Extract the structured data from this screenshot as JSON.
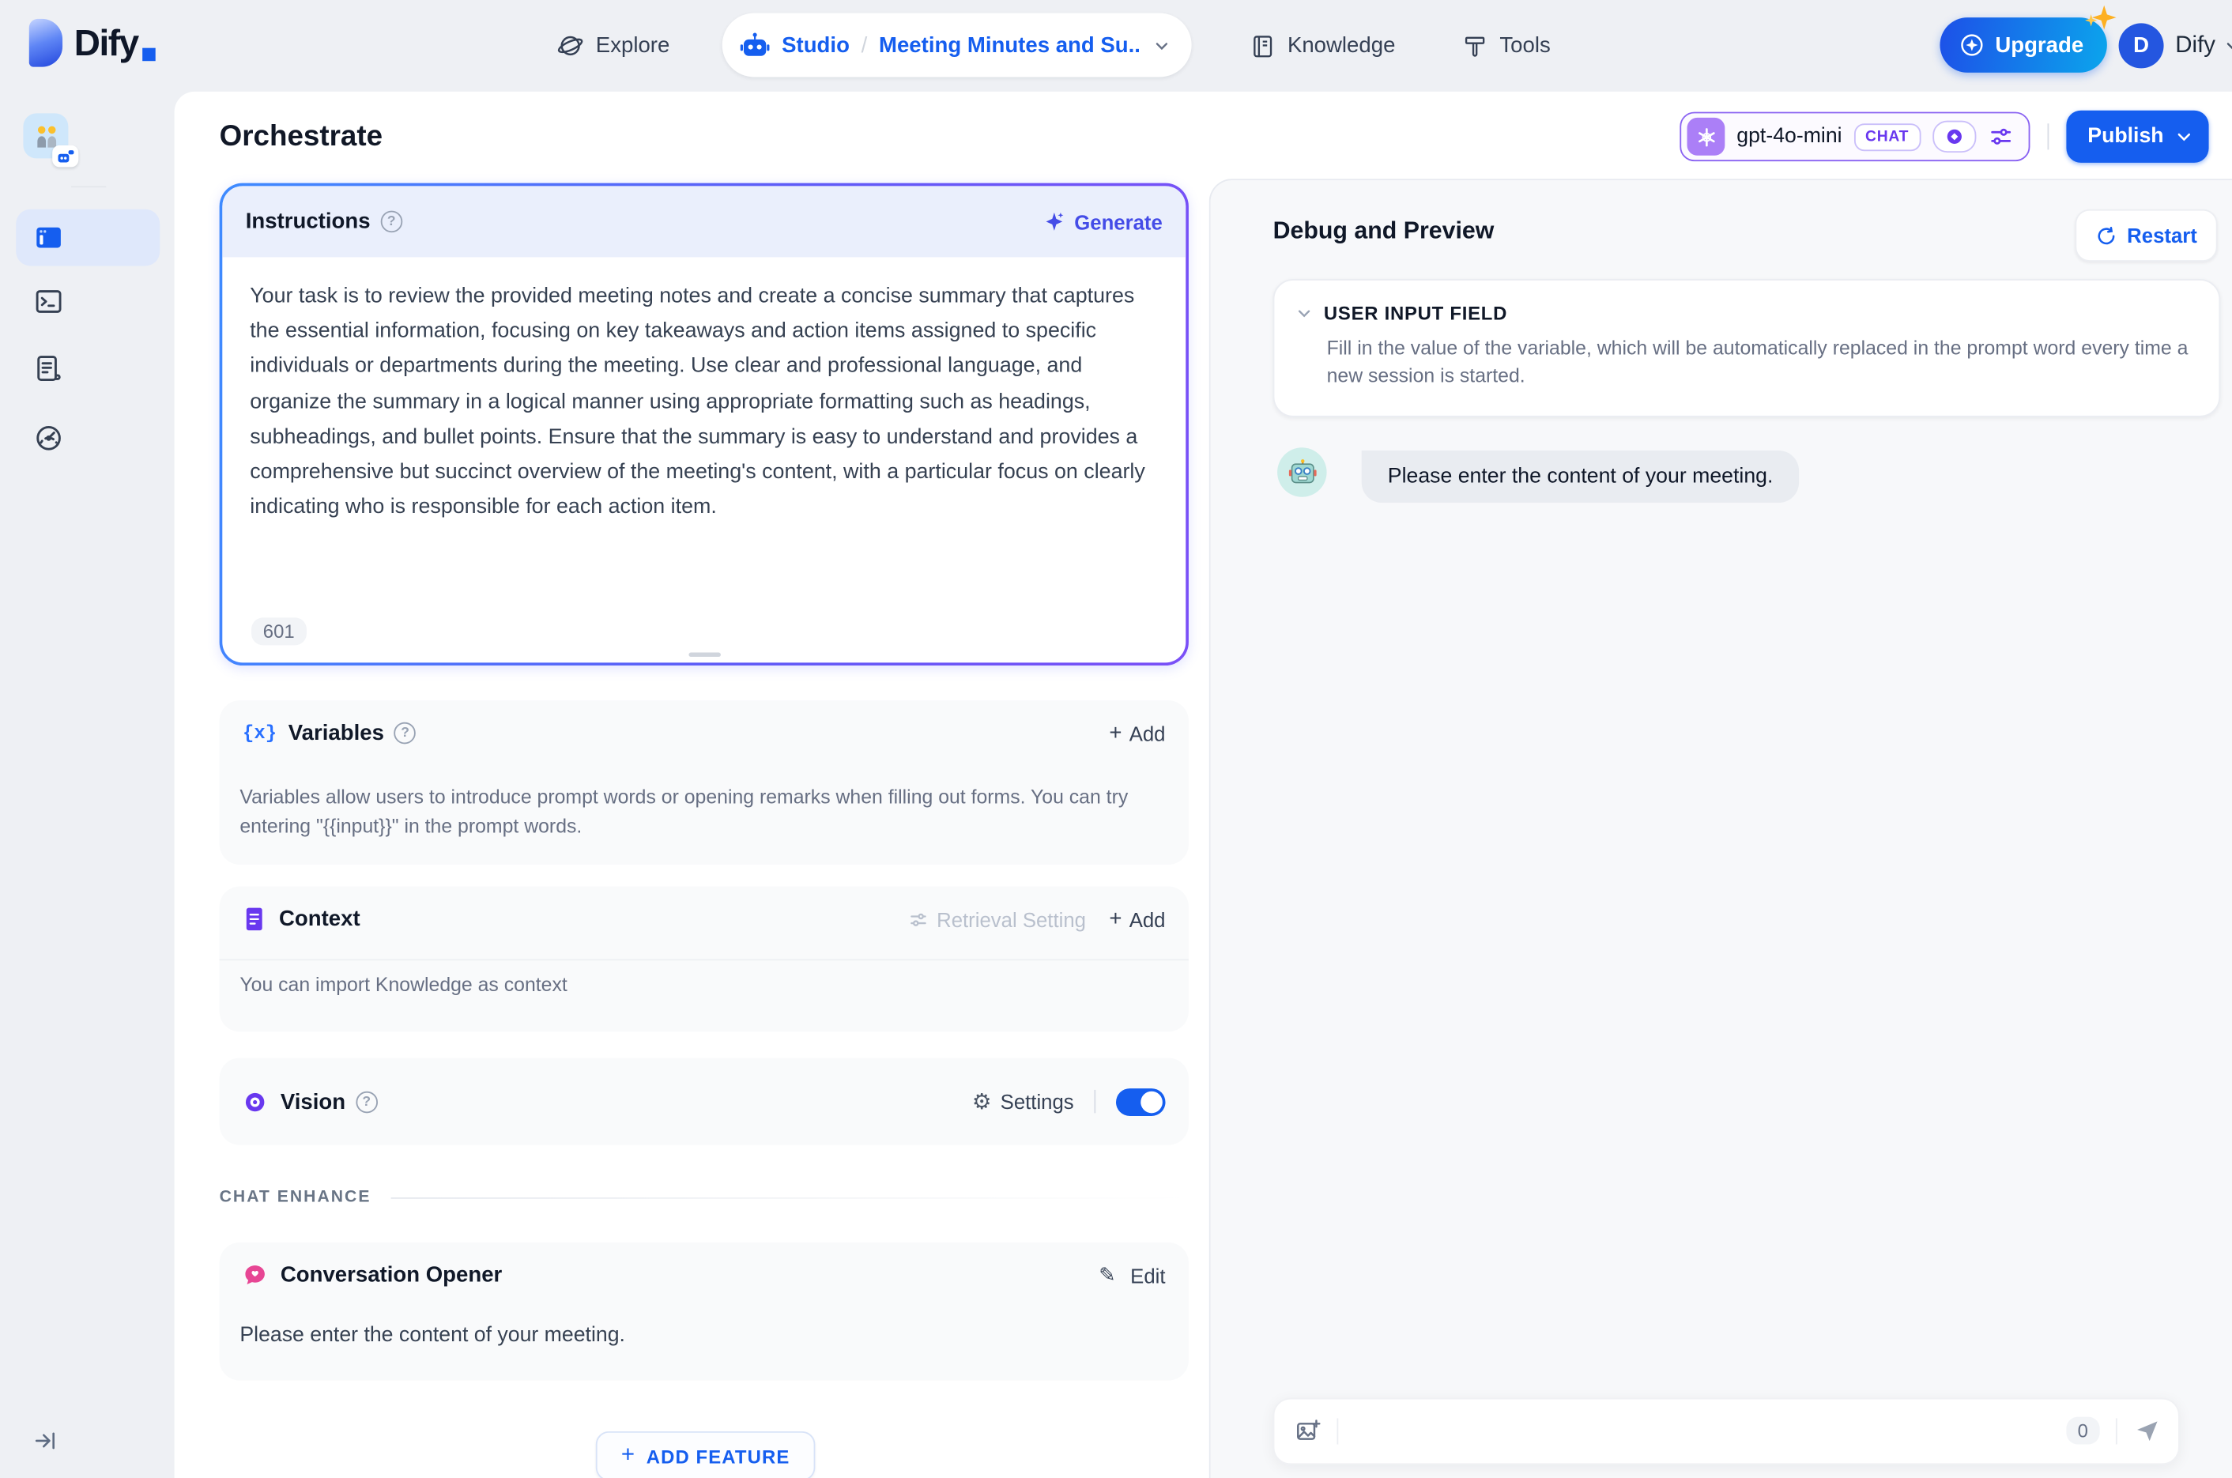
{
  "brand": {
    "logo_text": "Dify",
    "accent_color": "#155eef"
  },
  "topnav": {
    "explore_label": "Explore",
    "studio_label": "Studio",
    "breadcrumb_separator": "/",
    "app_name": "Meeting Minutes and Su...",
    "knowledge_label": "Knowledge",
    "tools_label": "Tools",
    "upgrade_label": "Upgrade",
    "avatar_initial": "D",
    "account_label": "Dify"
  },
  "sidebar": {
    "app_icon": "two-people-emoji",
    "app_badge_icon": "chat-robot-icon",
    "items": [
      {
        "name": "orchestrate",
        "icon": "app-window-icon",
        "active": true
      },
      {
        "name": "api-access",
        "icon": "terminal-icon",
        "active": false
      },
      {
        "name": "logs",
        "icon": "log-document-icon",
        "active": false
      },
      {
        "name": "monitoring",
        "icon": "gauge-icon",
        "active": false
      }
    ],
    "collapse_icon": "expand-sidebar-icon"
  },
  "header": {
    "page_title": "Orchestrate",
    "model": {
      "provider_icon": "openai-icon",
      "name": "gpt-4o-mini",
      "mode_badge": "CHAT",
      "border_color": "#8a63f2"
    },
    "publish_label": "Publish"
  },
  "instructions": {
    "title": "Instructions",
    "generate_label": "Generate",
    "body": "Your task is to review the provided meeting notes and create a concise summary that captures the essential information, focusing on key takeaways and action items assigned to specific individuals or departments during the meeting. Use clear and professional language, and organize the summary in a logical manner using appropriate formatting such as headings, subheadings, and bullet points. Ensure that the summary is easy to understand and provides a comprehensive but succinct overview of the meeting's content, with a particular focus on clearly indicating who is responsible for each action item.",
    "char_count": "601",
    "border_gradient": [
      "#3e8bff",
      "#7a4ff7"
    ]
  },
  "variables": {
    "title": "Variables",
    "add_label": "Add",
    "description": "Variables allow users to introduce prompt words or opening remarks when filling out forms. You can try entering \"{{input}}\" in the prompt words."
  },
  "context": {
    "title": "Context",
    "retrieval_setting_label": "Retrieval Setting",
    "add_label": "Add",
    "empty_hint": "You can import Knowledge as context"
  },
  "vision": {
    "title": "Vision",
    "settings_label": "Settings",
    "enabled": true
  },
  "chat_enhance": {
    "section_label": "CHAT ENHANCE"
  },
  "conversation_opener": {
    "title": "Conversation Opener",
    "edit_label": "Edit",
    "message": "Please enter the content of your meeting."
  },
  "add_feature": {
    "label": "ADD FEATURE"
  },
  "debug": {
    "title": "Debug and Preview",
    "restart_label": "Restart",
    "user_input_field": {
      "title": "USER INPUT FIELD",
      "description": "Fill in the value of the variable, which will be automatically replaced in the prompt word every time a new session is started."
    },
    "assistant_avatar": "robot-emoji",
    "assistant_message": "Please enter the content of your meeting.",
    "input": {
      "char_count": "0",
      "value": ""
    }
  },
  "icons": {
    "help_glyph": "?",
    "plus_glyph": "+",
    "gear_glyph": "⚙",
    "pencil_glyph": "✎",
    "braces_glyph": "{x}"
  }
}
